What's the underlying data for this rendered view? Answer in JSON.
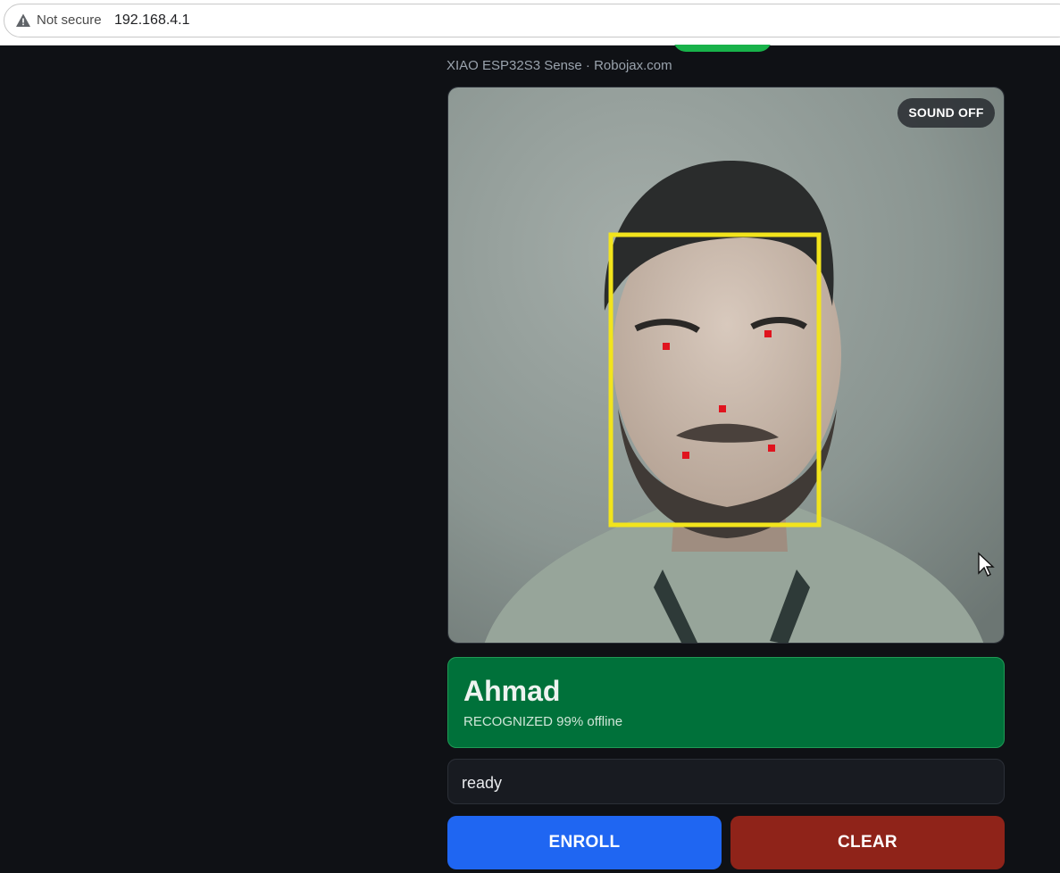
{
  "browser": {
    "security_label": "Not secure",
    "url": "192.168.4.1"
  },
  "header": {
    "subtitle": "XIAO ESP32S3 Sense · Robojax.com"
  },
  "camera": {
    "sound_toggle_label": "SOUND OFF",
    "face_box_color": "#f2e41c",
    "landmark_color": "#e0141e"
  },
  "result": {
    "name": "Ahmad",
    "status": "RECOGNIZED 99% offline",
    "color": "#00713a"
  },
  "status_line": {
    "text": "ready"
  },
  "actions": {
    "enroll_label": "ENROLL",
    "enroll_color": "#1f66f2",
    "clear_label": "CLEAR",
    "clear_color": "#8f2319"
  }
}
